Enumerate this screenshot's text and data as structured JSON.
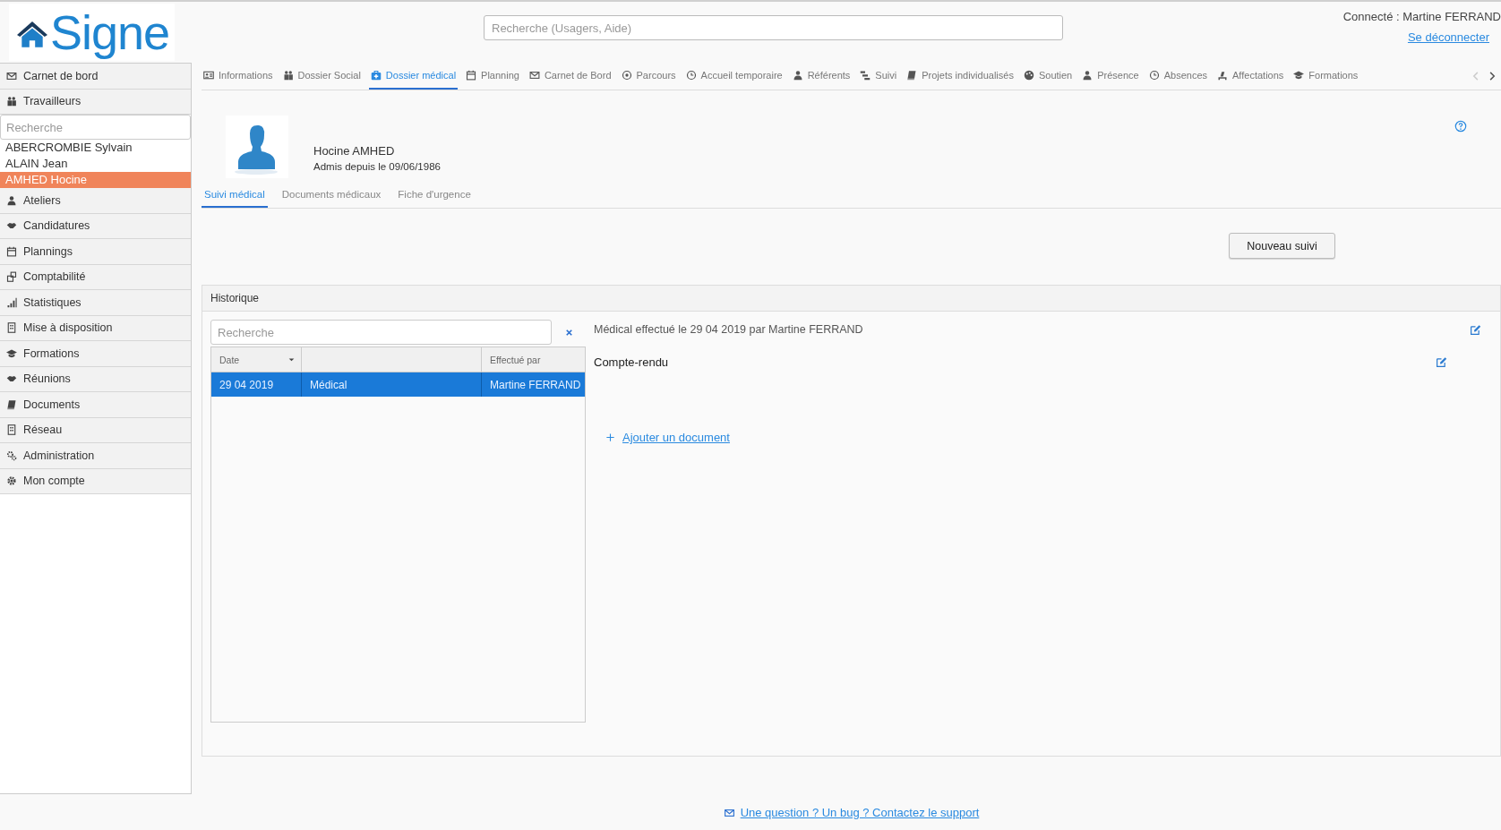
{
  "header": {
    "logo": "Signe",
    "search": {
      "placeholder": "Recherche (Usagers, Aide)"
    },
    "user": "Connecté : Martine FERRAND",
    "logout": "Se déconnecter"
  },
  "sidebar": {
    "items_top": [
      {
        "label": "Carnet de bord"
      },
      {
        "label": "Travailleurs"
      }
    ],
    "search": {
      "placeholder": "Recherche"
    },
    "people": [
      {
        "name": "ABERCROMBIE Sylvain",
        "selected": false
      },
      {
        "name": "ALAIN Jean",
        "selected": false
      },
      {
        "name": "AMHED Hocine",
        "selected": true
      }
    ],
    "items": [
      {
        "label": "Ateliers"
      },
      {
        "label": "Candidatures"
      },
      {
        "label": "Plannings"
      },
      {
        "label": "Comptabilité"
      },
      {
        "label": "Statistiques"
      },
      {
        "label": "Mise à disposition"
      },
      {
        "label": "Formations"
      },
      {
        "label": "Réunions"
      },
      {
        "label": "Documents"
      },
      {
        "label": "Réseau"
      },
      {
        "label": "Administration"
      },
      {
        "label": "Mon compte"
      }
    ]
  },
  "tabs": [
    {
      "label": "Informations",
      "selected": false
    },
    {
      "label": "Dossier Social",
      "selected": false
    },
    {
      "label": "Dossier médical",
      "selected": true
    },
    {
      "label": "Planning",
      "selected": false
    },
    {
      "label": "Carnet de Bord",
      "selected": false
    },
    {
      "label": "Parcours",
      "selected": false
    },
    {
      "label": "Accueil temporaire",
      "selected": false
    },
    {
      "label": "Référents",
      "selected": false
    },
    {
      "label": "Suivi",
      "selected": false
    },
    {
      "label": "Projets individualisés",
      "selected": false
    },
    {
      "label": "Soutien",
      "selected": false
    },
    {
      "label": "Présence",
      "selected": false
    },
    {
      "label": "Absences",
      "selected": false
    },
    {
      "label": "Affectations",
      "selected": false
    },
    {
      "label": "Formations",
      "selected": false
    }
  ],
  "patient": {
    "name": "Hocine AMHED",
    "admitted": "Admis depuis le 09/06/1986"
  },
  "subtabs": [
    {
      "label": "Suivi médical",
      "selected": true
    },
    {
      "label": "Documents médicaux",
      "selected": false
    },
    {
      "label": "Fiche d'urgence",
      "selected": false
    }
  ],
  "new_button": "Nouveau suivi",
  "history": {
    "title": "Historique",
    "search": {
      "placeholder": "Recherche"
    },
    "header": {
      "column_1": "Date",
      "column_3": "Effectué par"
    },
    "rows": [
      {
        "date": "29 04 2019",
        "type": "Médical",
        "by": "Martine FERRAND",
        "selected": true
      }
    ],
    "detail": {
      "summary": "Médical effectué le 29 04 2019 par Martine FERRAND",
      "report_label": "Compte-rendu",
      "add_document": "Ajouter un document"
    }
  },
  "footer": {
    "support": "Une question ? Un bug ? Contactez le support"
  }
}
